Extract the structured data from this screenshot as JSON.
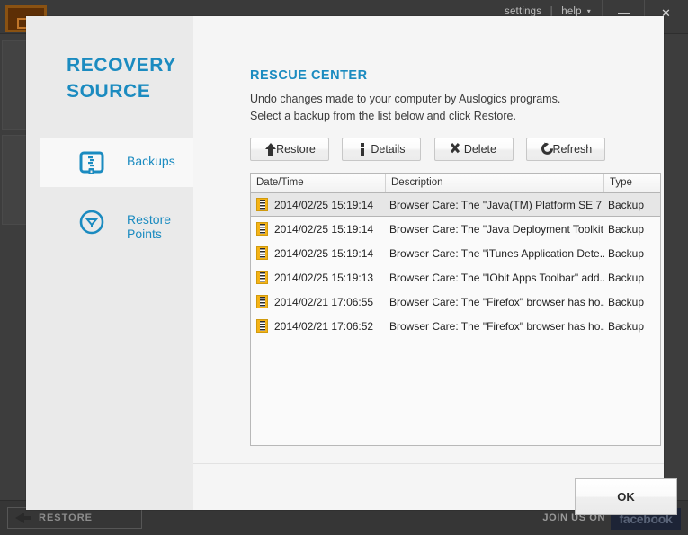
{
  "background": {
    "menu": {
      "settings": "settings",
      "separator": "|",
      "help": "help",
      "caret": "▾"
    },
    "window_controls": {
      "minimize": "—",
      "close": "✕"
    },
    "footer": {
      "restore_label": "RESTORE",
      "join_label": "JOIN US ON",
      "facebook_label": "facebook"
    }
  },
  "dialog": {
    "close_icon": "✖",
    "sidebar": {
      "brand_line1": "RECOVERY",
      "brand_line2": "SOURCE",
      "items": [
        {
          "label": "Backups",
          "icon": "archive-zip-icon",
          "active": true
        },
        {
          "label": "Restore Points",
          "icon": "clock-restore-icon",
          "active": false
        }
      ]
    },
    "main": {
      "title": "RESCUE CENTER",
      "description_line1": "Undo changes made to your computer by Auslogics programs.",
      "description_line2": "Select a backup from the list below and click Restore.",
      "toolbar": [
        {
          "label": "Restore",
          "icon": "up-arrow-icon"
        },
        {
          "label": "Details",
          "icon": "info-icon"
        },
        {
          "label": "Delete",
          "icon": "x-cross-icon"
        },
        {
          "label": "Refresh",
          "icon": "refresh-icon"
        }
      ],
      "table": {
        "columns": [
          "Date/Time",
          "Description",
          "Type"
        ],
        "rows": [
          {
            "date": "2014/02/25 15:19:14",
            "description": "Browser Care: The \"Java(TM) Platform SE 7 ...",
            "type": "Backup",
            "selected": true
          },
          {
            "date": "2014/02/25 15:19:14",
            "description": "Browser Care: The \"Java Deployment Toolkit ...",
            "type": "Backup",
            "selected": false
          },
          {
            "date": "2014/02/25 15:19:14",
            "description": "Browser Care: The \"iTunes Application Dete...",
            "type": "Backup",
            "selected": false
          },
          {
            "date": "2014/02/25 15:19:13",
            "description": "Browser Care: The \"IObit Apps Toolbar\" add...",
            "type": "Backup",
            "selected": false
          },
          {
            "date": "2014/02/21 17:06:55",
            "description": "Browser Care: The \"Firefox\" browser has ho...",
            "type": "Backup",
            "selected": false
          },
          {
            "date": "2014/02/21 17:06:52",
            "description": "Browser Care: The \"Firefox\" browser has ho...",
            "type": "Backup",
            "selected": false
          }
        ]
      },
      "ok_label": "OK"
    }
  },
  "colors": {
    "accent_blue": "#1b8bc0",
    "dialog_bg": "#f5f5f5",
    "sidebar_bg": "#eaeaea",
    "app_bg": "#3d3d3d",
    "row_icon": "#f5b316"
  }
}
